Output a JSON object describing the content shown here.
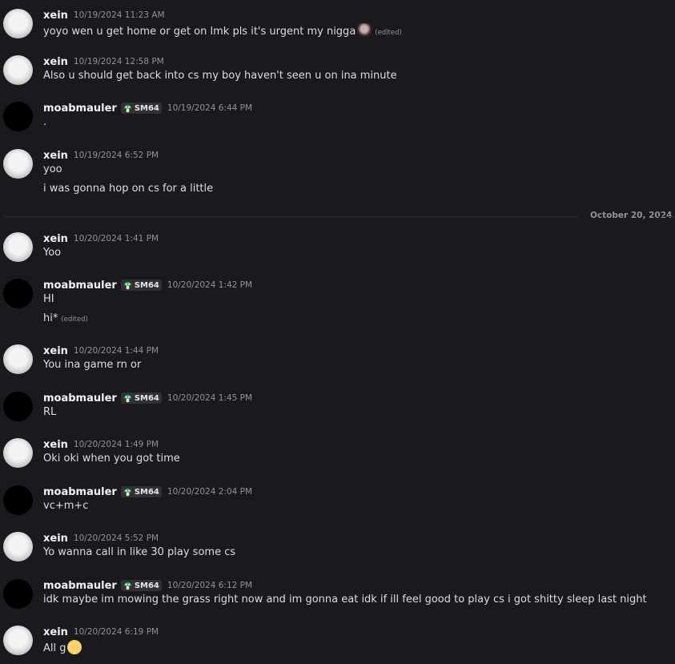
{
  "date_divider": "October 20, 2024",
  "messages": [
    {
      "user": "xein",
      "ts": "10/19/2024 11:23 AM",
      "lines": [
        "yoyo wen u get home or get on lmk pls it's urgent my nigga"
      ],
      "edited": "(edited)"
    },
    {
      "user": "xein",
      "ts": "10/19/2024 12:58 PM",
      "lines": [
        "Also u should get back into cs my boy haven't seen u on ina minute"
      ]
    },
    {
      "user": "moabmauler",
      "tag": "SM64",
      "ts": "10/19/2024 6:44 PM",
      "lines": [
        "."
      ]
    },
    {
      "user": "xein",
      "ts": "10/19/2024 6:52 PM",
      "lines": [
        "yoo",
        "i was gonna hop on cs for a little"
      ]
    },
    {
      "user": "xein",
      "ts": "10/20/2024 1:41 PM",
      "lines": [
        "Yoo"
      ]
    },
    {
      "user": "moabmauler",
      "tag": "SM64",
      "ts": "10/20/2024 1:42 PM",
      "lines": [
        "HI",
        "hi*"
      ],
      "edited": "(edited)"
    },
    {
      "user": "xein",
      "ts": "10/20/2024 1:44 PM",
      "lines": [
        "You ina game rn or"
      ]
    },
    {
      "user": "moabmauler",
      "tag": "SM64",
      "ts": "10/20/2024 1:45 PM",
      "lines": [
        "RL"
      ]
    },
    {
      "user": "xein",
      "ts": "10/20/2024 1:49 PM",
      "lines": [
        "Oki oki when you got time"
      ]
    },
    {
      "user": "moabmauler",
      "tag": "SM64",
      "ts": "10/20/2024 2:04 PM",
      "lines": [
        "vc+m+c"
      ]
    },
    {
      "user": "xein",
      "ts": "10/20/2024 5:52 PM",
      "lines": [
        "Yo wanna call in like 30 play some cs"
      ]
    },
    {
      "user": "moabmauler",
      "tag": "SM64",
      "ts": "10/20/2024 6:12 PM",
      "lines": [
        "idk maybe im mowing the grass right now and im gonna eat idk if ill feel good to play cs i got shitty sleep last night"
      ]
    },
    {
      "user": "xein",
      "ts": "10/20/2024 6:19 PM",
      "lines": [
        "All g"
      ]
    }
  ]
}
